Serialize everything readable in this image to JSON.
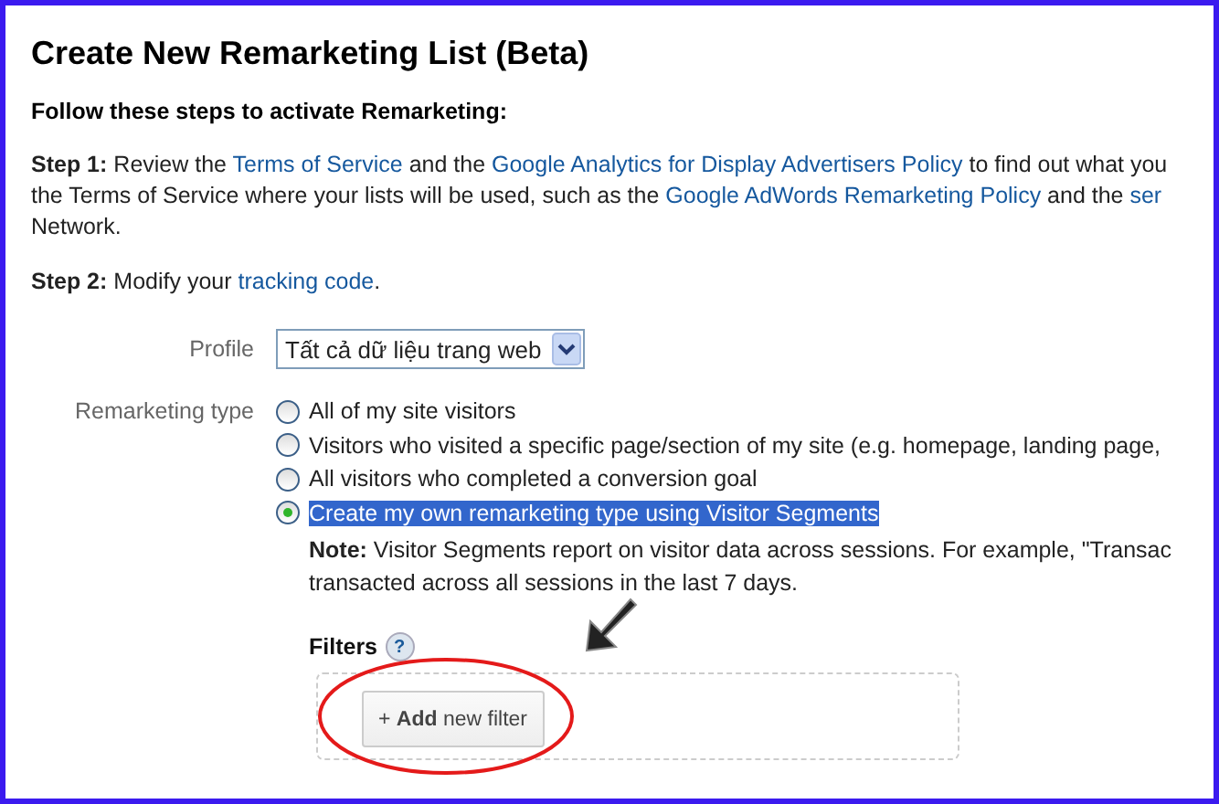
{
  "title": "Create New Remarketing List (Beta)",
  "intro": "Follow these steps to activate Remarketing:",
  "step1_lines": [
    [
      {
        "text": "**Step 1:** Review the ",
        "link": false
      },
      {
        "text": "Terms of Service",
        "link": true
      },
      {
        "text": " and the ",
        "link": false
      },
      {
        "text": "Google Analytics for Display Advertisers Policy",
        "link": true
      },
      {
        "text": " to find out what you",
        "link": false
      }
    ],
    [
      {
        "text": "the Terms of Service where your lists will be used, such as the ",
        "link": false
      },
      {
        "text": "Google AdWords Remarketing Policy",
        "link": true
      },
      {
        "text": " and the ",
        "link": false
      },
      {
        "text": "ser",
        "link": true
      }
    ],
    [
      {
        "text": "Network.",
        "link": false
      }
    ]
  ],
  "step2": [
    {
      "text": "**Step 2:** Modify your ",
      "link": false
    },
    {
      "text": "tracking code",
      "link": true
    },
    {
      "text": ".",
      "link": false
    }
  ],
  "profile": {
    "label": "Profile",
    "value": "Tất cả dữ liệu trang web"
  },
  "remarketing_type": {
    "label": "Remarketing type",
    "options": [
      {
        "label": "All of my site visitors",
        "selected": false
      },
      {
        "label": "Visitors who visited a specific page/section of my site (e.g. homepage, landing page,",
        "selected": false
      },
      {
        "label": "All visitors who completed a conversion goal",
        "selected": false
      },
      {
        "label": "Create my own remarketing type using Visitor Segments",
        "selected": true
      }
    ]
  },
  "note_lines": [
    "**Note:** Visitor Segments report on visitor data across sessions. For example, \"Transac",
    "transacted across all sessions in the last 7 days."
  ],
  "filters": {
    "label": "Filters",
    "help": "?",
    "add_button": "+ **Add** new filter"
  }
}
